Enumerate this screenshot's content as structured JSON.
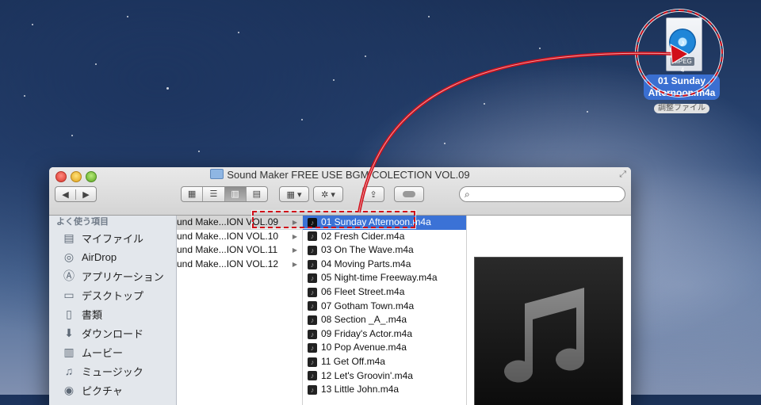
{
  "window": {
    "title": "Sound Maker FREE USE BGM COLECTION VOL.09",
    "search_placeholder": ""
  },
  "toolbar": {
    "back": "◀",
    "forward": "▶",
    "views": [
      "▦",
      "☰",
      "▥",
      "▤"
    ],
    "arrange": "▦ ▾",
    "action": "✲ ▾",
    "share": "⇪"
  },
  "sidebar": {
    "header": "よく使う項目",
    "items": [
      {
        "label": "マイファイル",
        "icon": "all-my-files-icon"
      },
      {
        "label": "AirDrop",
        "icon": "airdrop-icon"
      },
      {
        "label": "アプリケーション",
        "icon": "applications-icon"
      },
      {
        "label": "デスクトップ",
        "icon": "desktop-icon"
      },
      {
        "label": "書類",
        "icon": "documents-icon"
      },
      {
        "label": "ダウンロード",
        "icon": "downloads-icon"
      },
      {
        "label": "ムービー",
        "icon": "movies-icon"
      },
      {
        "label": "ミュージック",
        "icon": "music-icon"
      },
      {
        "label": "ピクチャ",
        "icon": "pictures-icon"
      }
    ]
  },
  "column1": {
    "items": [
      {
        "label": "und Make...ION VOL.09",
        "selected": true
      },
      {
        "label": "und Make...ION VOL.10",
        "selected": false
      },
      {
        "label": "und Make...ION VOL.11",
        "selected": false
      },
      {
        "label": "und Make...ION VOL.12",
        "selected": false
      }
    ]
  },
  "column2": {
    "items": [
      {
        "label": "01 Sunday Afternoon.m4a",
        "selected": true
      },
      {
        "label": "02 Fresh Cider.m4a",
        "selected": false
      },
      {
        "label": "03 On The Wave.m4a",
        "selected": false
      },
      {
        "label": "04 Moving Parts.m4a",
        "selected": false
      },
      {
        "label": "05 Night-time Freeway.m4a",
        "selected": false
      },
      {
        "label": "06 Fleet Street.m4a",
        "selected": false
      },
      {
        "label": "07 Gotham Town.m4a",
        "selected": false
      },
      {
        "label": "08 Section _A_.m4a",
        "selected": false
      },
      {
        "label": "09 Friday's Actor.m4a",
        "selected": false
      },
      {
        "label": "10 Pop Avenue.m4a",
        "selected": false
      },
      {
        "label": "11 Get Off.m4a",
        "selected": false
      },
      {
        "label": "12 Let's Groovin'.m4a",
        "selected": false
      },
      {
        "label": "13 Little John.m4a",
        "selected": false
      }
    ]
  },
  "desktop_file": {
    "badge": "MPEG 4",
    "name_line1": "01 Sunday",
    "name_line2": "Afternoon.m4a",
    "subtitle": "調整ファイル"
  },
  "colors": {
    "selection": "#3b72d6",
    "annotation": "#d10f1a"
  }
}
